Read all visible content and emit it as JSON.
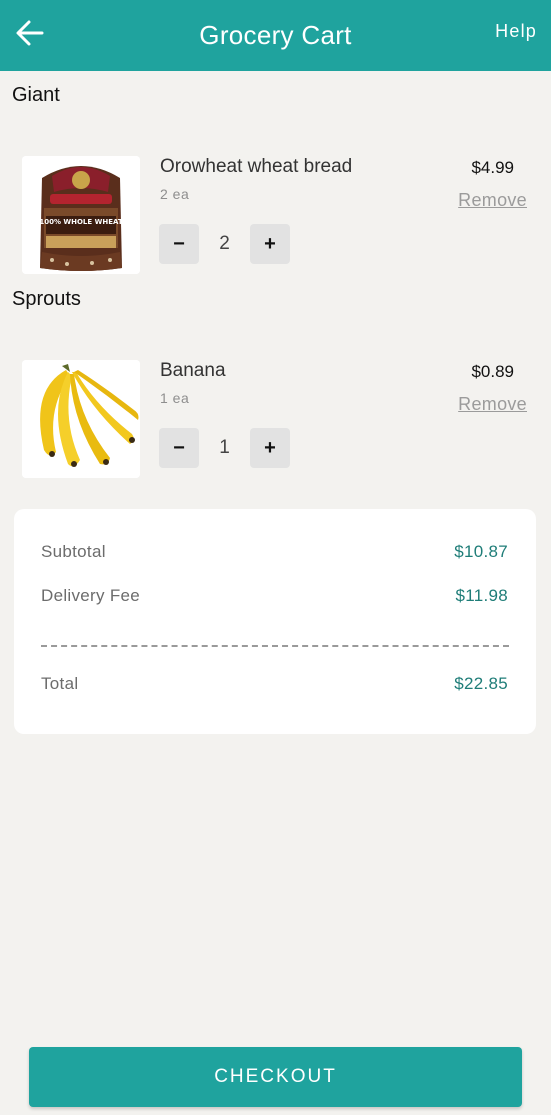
{
  "header": {
    "title": "Grocery Cart",
    "help_label": "Help",
    "back_icon": "arrow-left-icon",
    "background": "#1fa39e"
  },
  "stores": [
    {
      "name": "Giant",
      "items": [
        {
          "name": "Orowheat wheat bread",
          "unit": "2 ea",
          "quantity": "2",
          "price": "$4.99",
          "remove_label": "Remove",
          "image": "bread-image",
          "image_text": "100% WHOLE WHEAT"
        }
      ]
    },
    {
      "name": "Sprouts",
      "items": [
        {
          "name": "Banana",
          "unit": "1 ea",
          "quantity": "1",
          "price": "$0.89",
          "remove_label": "Remove",
          "image": "banana-image"
        }
      ]
    }
  ],
  "qty_controls": {
    "minus": "−",
    "plus": "+"
  },
  "summary": {
    "subtotal_label": "Subtotal",
    "subtotal_value": "$10.87",
    "delivery_label": "Delivery Fee",
    "delivery_value": "$11.98",
    "total_label": "Total",
    "total_value": "$22.85"
  },
  "checkout_label": "CHECKOUT",
  "colors": {
    "accent": "#1fa39e",
    "price_green": "#1f7d78",
    "background": "#f3f2ef"
  }
}
